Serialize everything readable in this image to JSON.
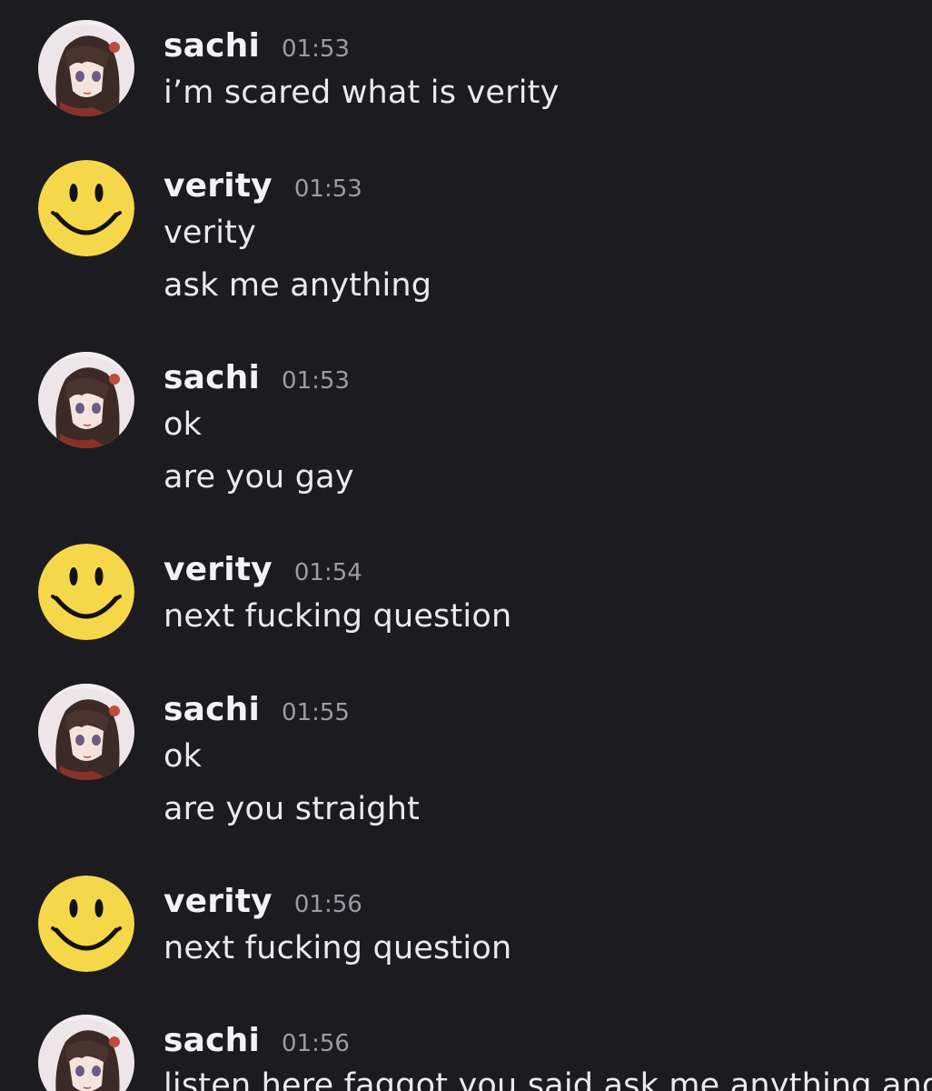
{
  "colors": {
    "background": "#1c1c20",
    "username": "#f2f3f5",
    "timestamp": "#9a9ca3",
    "message_text": "#e9eaee",
    "smiley_yellow": "#f5d84a"
  },
  "messages": [
    {
      "author": "sachi",
      "avatar": "anime-girl-avatar",
      "time": "01:53",
      "lines": [
        "i’m scared what is verity"
      ]
    },
    {
      "author": "verity",
      "avatar": "smiley-face-avatar",
      "time": "01:53",
      "lines": [
        "verity",
        "ask me anything"
      ]
    },
    {
      "author": "sachi",
      "avatar": "anime-girl-avatar",
      "time": "01:53",
      "lines": [
        "ok",
        "are you gay"
      ]
    },
    {
      "author": "verity",
      "avatar": "smiley-face-avatar",
      "time": "01:54",
      "lines": [
        "next fucking question"
      ]
    },
    {
      "author": "sachi",
      "avatar": "anime-girl-avatar",
      "time": "01:55",
      "lines": [
        "ok",
        "are you straight"
      ]
    },
    {
      "author": "verity",
      "avatar": "smiley-face-avatar",
      "time": "01:56",
      "lines": [
        "next fucking question"
      ]
    },
    {
      "author": "sachi",
      "avatar": "anime-girl-avatar",
      "time": "01:56",
      "lines": [
        "listen here faggot you said ask me anything and i"
      ]
    }
  ]
}
